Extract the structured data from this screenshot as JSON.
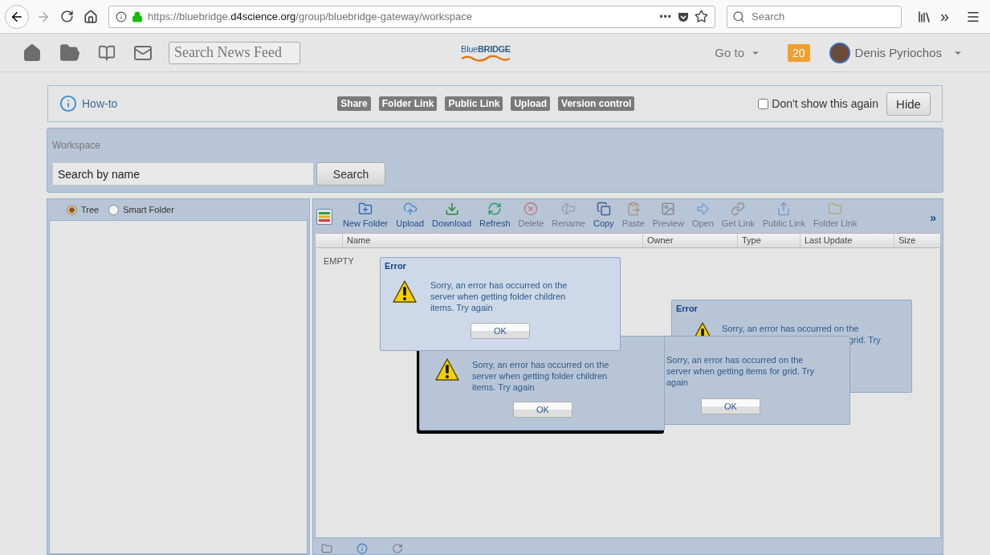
{
  "browser": {
    "back_disabled": false,
    "forward_disabled": true,
    "url": {
      "prefix": "https://bluebridge.",
      "domain": "d4science.org",
      "path": "/group/bluebridge-gateway/workspace"
    },
    "more": "•••",
    "search_placeholder": "Search",
    "overflow": "»"
  },
  "navbar": {
    "search_placeholder": "Search News Feed",
    "logo_light": "Blue",
    "logo_bold": "BRIDGE",
    "goto": "Go to",
    "notifications": "20",
    "user": "Denis Pyriochos"
  },
  "howto": {
    "label": "How-to",
    "tags": [
      "Share",
      "Folder Link",
      "Public Link",
      "Upload",
      "Version control"
    ],
    "dont_show": {
      "label": "Don't show this again",
      "checked": false
    },
    "hide": "Hide"
  },
  "workspace": {
    "title": "Workspace",
    "search_placeholder": "Search by name",
    "search_button": "Search"
  },
  "view_options": [
    {
      "label": "Tree",
      "selected": true
    },
    {
      "label": "Smart Folder",
      "selected": false
    }
  ],
  "toolbar": [
    {
      "label": "New Folder",
      "disabled": false
    },
    {
      "label": "Upload",
      "disabled": false
    },
    {
      "label": "Download",
      "disabled": false
    },
    {
      "label": "Refresh",
      "disabled": false
    },
    {
      "label": "Delete",
      "disabled": true
    },
    {
      "label": "Rename",
      "disabled": true
    },
    {
      "label": "Copy",
      "disabled": false
    },
    {
      "label": "Paste",
      "disabled": true
    },
    {
      "label": "Preview",
      "disabled": true
    },
    {
      "label": "Open",
      "disabled": true
    },
    {
      "label": "Get Link",
      "disabled": true
    },
    {
      "label": "Public Link",
      "disabled": true
    },
    {
      "label": "Folder Link",
      "disabled": true
    }
  ],
  "toolbar_more": "»",
  "table": {
    "columns": [
      "Name",
      "Owner",
      "Type",
      "Last Update",
      "Size"
    ],
    "empty": "EMPTY"
  },
  "dialogs": [
    {
      "title": "Error",
      "lines": [
        "Sorry, an error has occurred on the",
        "server when getting folder children",
        "items. Try again"
      ],
      "button": "OK"
    },
    {
      "lines": [
        "Sorry, an error has occurred on the",
        "server when getting folder children",
        "items. Try again"
      ],
      "button": "OK"
    },
    {
      "title": "Error",
      "lines": [
        "Sorry, an error has occurred on the",
        "grid. Try"
      ]
    },
    {
      "lines": [
        "Sorry, an error has occurred on the",
        "server when getting items for grid. Try",
        "again"
      ],
      "button": "OK"
    }
  ]
}
